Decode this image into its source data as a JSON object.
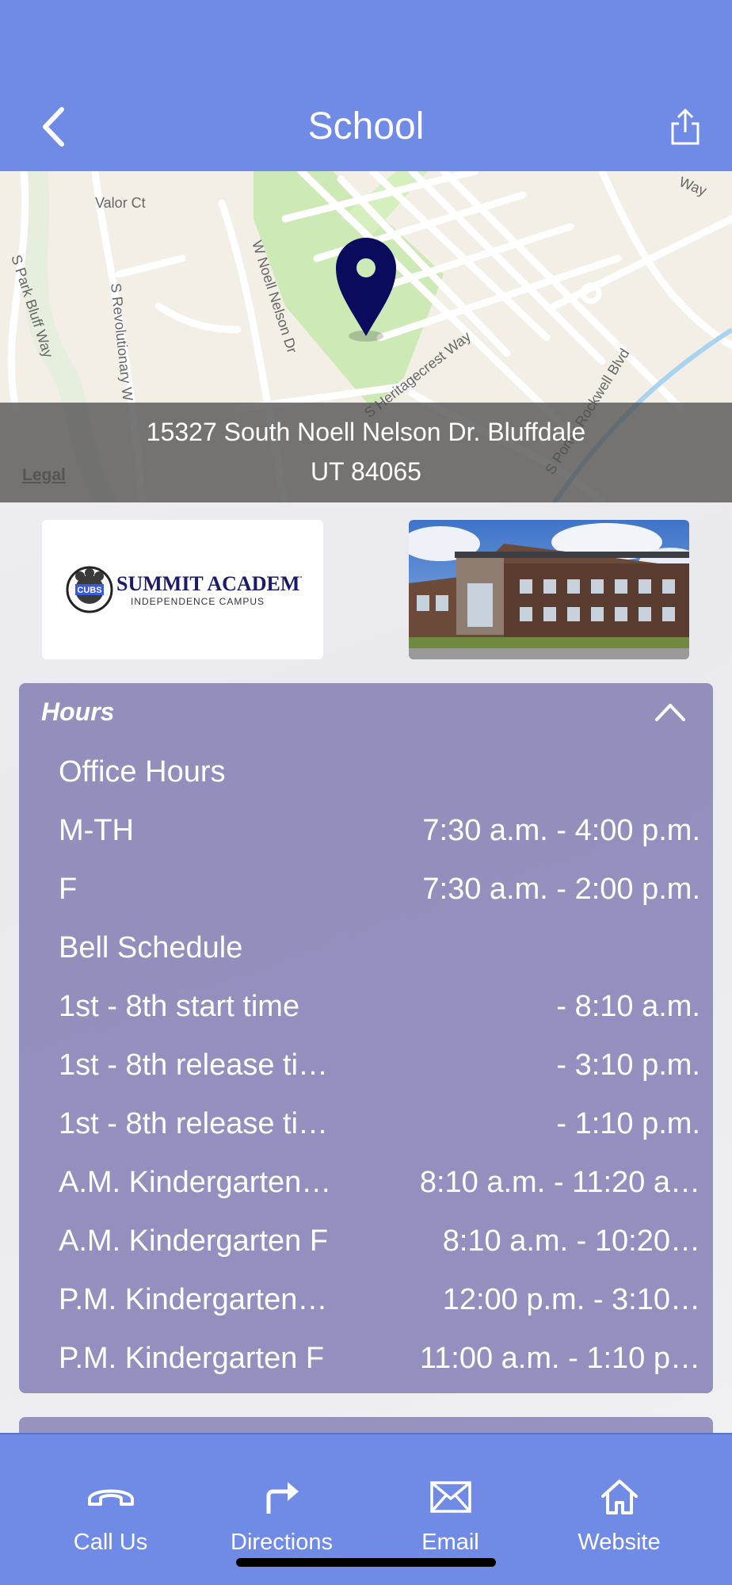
{
  "header": {
    "title": "School",
    "back_icon": "chevron-left-icon",
    "share_icon": "share-icon"
  },
  "map": {
    "street_labels": [
      "Valor Ct",
      "S Park Bluff Way",
      "S Revolutionary W",
      "W Noell Nelson Dr",
      "S Heritagecrest Way",
      "S Porter Rockwell Blvd",
      "Way"
    ],
    "pin_icon": "map-pin-icon",
    "address_line1": "15327 South Noell Nelson Dr. Bluffdale",
    "address_line2": "UT 84065",
    "legal": "Legal"
  },
  "logo": {
    "name": "SUMMIT ACADEMY",
    "subtitle": "INDEPENDENCE CAMPUS"
  },
  "hours": {
    "title": "Hours",
    "collapse_icon": "chevron-up-icon",
    "rows": [
      {
        "label": "Office Hours",
        "value": ""
      },
      {
        "label": "M-TH",
        "value": "7:30 a.m. - 4:00 p.m."
      },
      {
        "label": "F",
        "value": "7:30 a.m. - 2:00 p.m."
      },
      {
        "label": "Bell Schedule",
        "value": ""
      },
      {
        "label": "1st - 8th start time",
        "value": "- 8:10 a.m."
      },
      {
        "label": "1st - 8th release ti…",
        "value": "- 3:10 p.m."
      },
      {
        "label": "1st - 8th release ti…",
        "value": "- 1:10 p.m."
      },
      {
        "label": "A.M. Kindergarten…",
        "value": "8:10 a.m. - 11:20 a…"
      },
      {
        "label": "A.M. Kindergarten F",
        "value": "8:10 a.m. - 10:20…"
      },
      {
        "label": "P.M. Kindergarten…",
        "value": "12:00 p.m. - 3:10…"
      },
      {
        "label": "P.M. Kindergarten F",
        "value": "11:00 a.m. - 1:10 p…"
      }
    ]
  },
  "tabbar": {
    "items": [
      {
        "label": "Call Us",
        "icon": "phone-icon"
      },
      {
        "label": "Directions",
        "icon": "directions-icon"
      },
      {
        "label": "Email",
        "icon": "email-icon"
      },
      {
        "label": "Website",
        "icon": "home-icon"
      }
    ]
  },
  "colors": {
    "header_bg": "#6f8be6",
    "panel_bg": "#8682b6",
    "pin": "#0b0b5e"
  }
}
